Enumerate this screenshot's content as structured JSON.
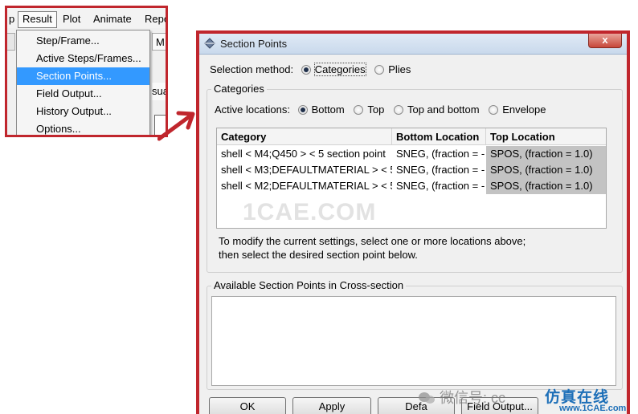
{
  "menu": {
    "bar": {
      "partial_left": "p",
      "result": "Result",
      "plot": "Plot",
      "animate": "Animate",
      "partial_right": "Repo"
    },
    "items": [
      {
        "label": "Step/Frame..."
      },
      {
        "label": "Active Steps/Frames..."
      },
      {
        "label": "Section Points..."
      },
      {
        "label": "Field Output..."
      },
      {
        "label": "History Output..."
      },
      {
        "label": "Options..."
      }
    ],
    "partial_m": "M",
    "partial_sua": "sua"
  },
  "dialog": {
    "title": "Section Points",
    "close_label": "x",
    "selection_method_label": "Selection method:",
    "selection_options": [
      "Categories",
      "Plies"
    ],
    "categories_group": "Categories",
    "active_locations_label": "Active locations:",
    "location_options": [
      "Bottom",
      "Top",
      "Top and bottom",
      "Envelope"
    ],
    "table": {
      "headers": [
        "Category",
        "Bottom Location",
        "Top Location"
      ],
      "rows": [
        [
          "shell < M4;Q450 > < 5 section point",
          "SNEG, (fraction = -",
          "SPOS, (fraction = 1.0)"
        ],
        [
          "shell < M3;DEFAULTMATERIAL > < 5",
          "SNEG, (fraction = -",
          "SPOS, (fraction = 1.0)"
        ],
        [
          "shell < M2;DEFAULTMATERIAL > < 5",
          "SNEG, (fraction = -",
          "SPOS, (fraction = 1.0)"
        ]
      ]
    },
    "info_line1": "To modify the current settings, select one or more locations above;",
    "info_line2": "then select the desired section point below.",
    "available_group": "Available Section Points in Cross-section",
    "buttons": {
      "ok": "OK",
      "apply": "Apply",
      "defaults": "Defa",
      "field_output": "Field Output..."
    }
  },
  "watermarks": {
    "center": "1CAE.COM",
    "wechat": "微信号: cc",
    "logo_cn": "仿真在线",
    "logo_url": "www.1CAE.com"
  },
  "colors": {
    "highlight": "#3399ff",
    "frame_red": "#c0262d",
    "selected_cell": "#c3c3c3",
    "logo_blue": "#1d6fb8"
  }
}
